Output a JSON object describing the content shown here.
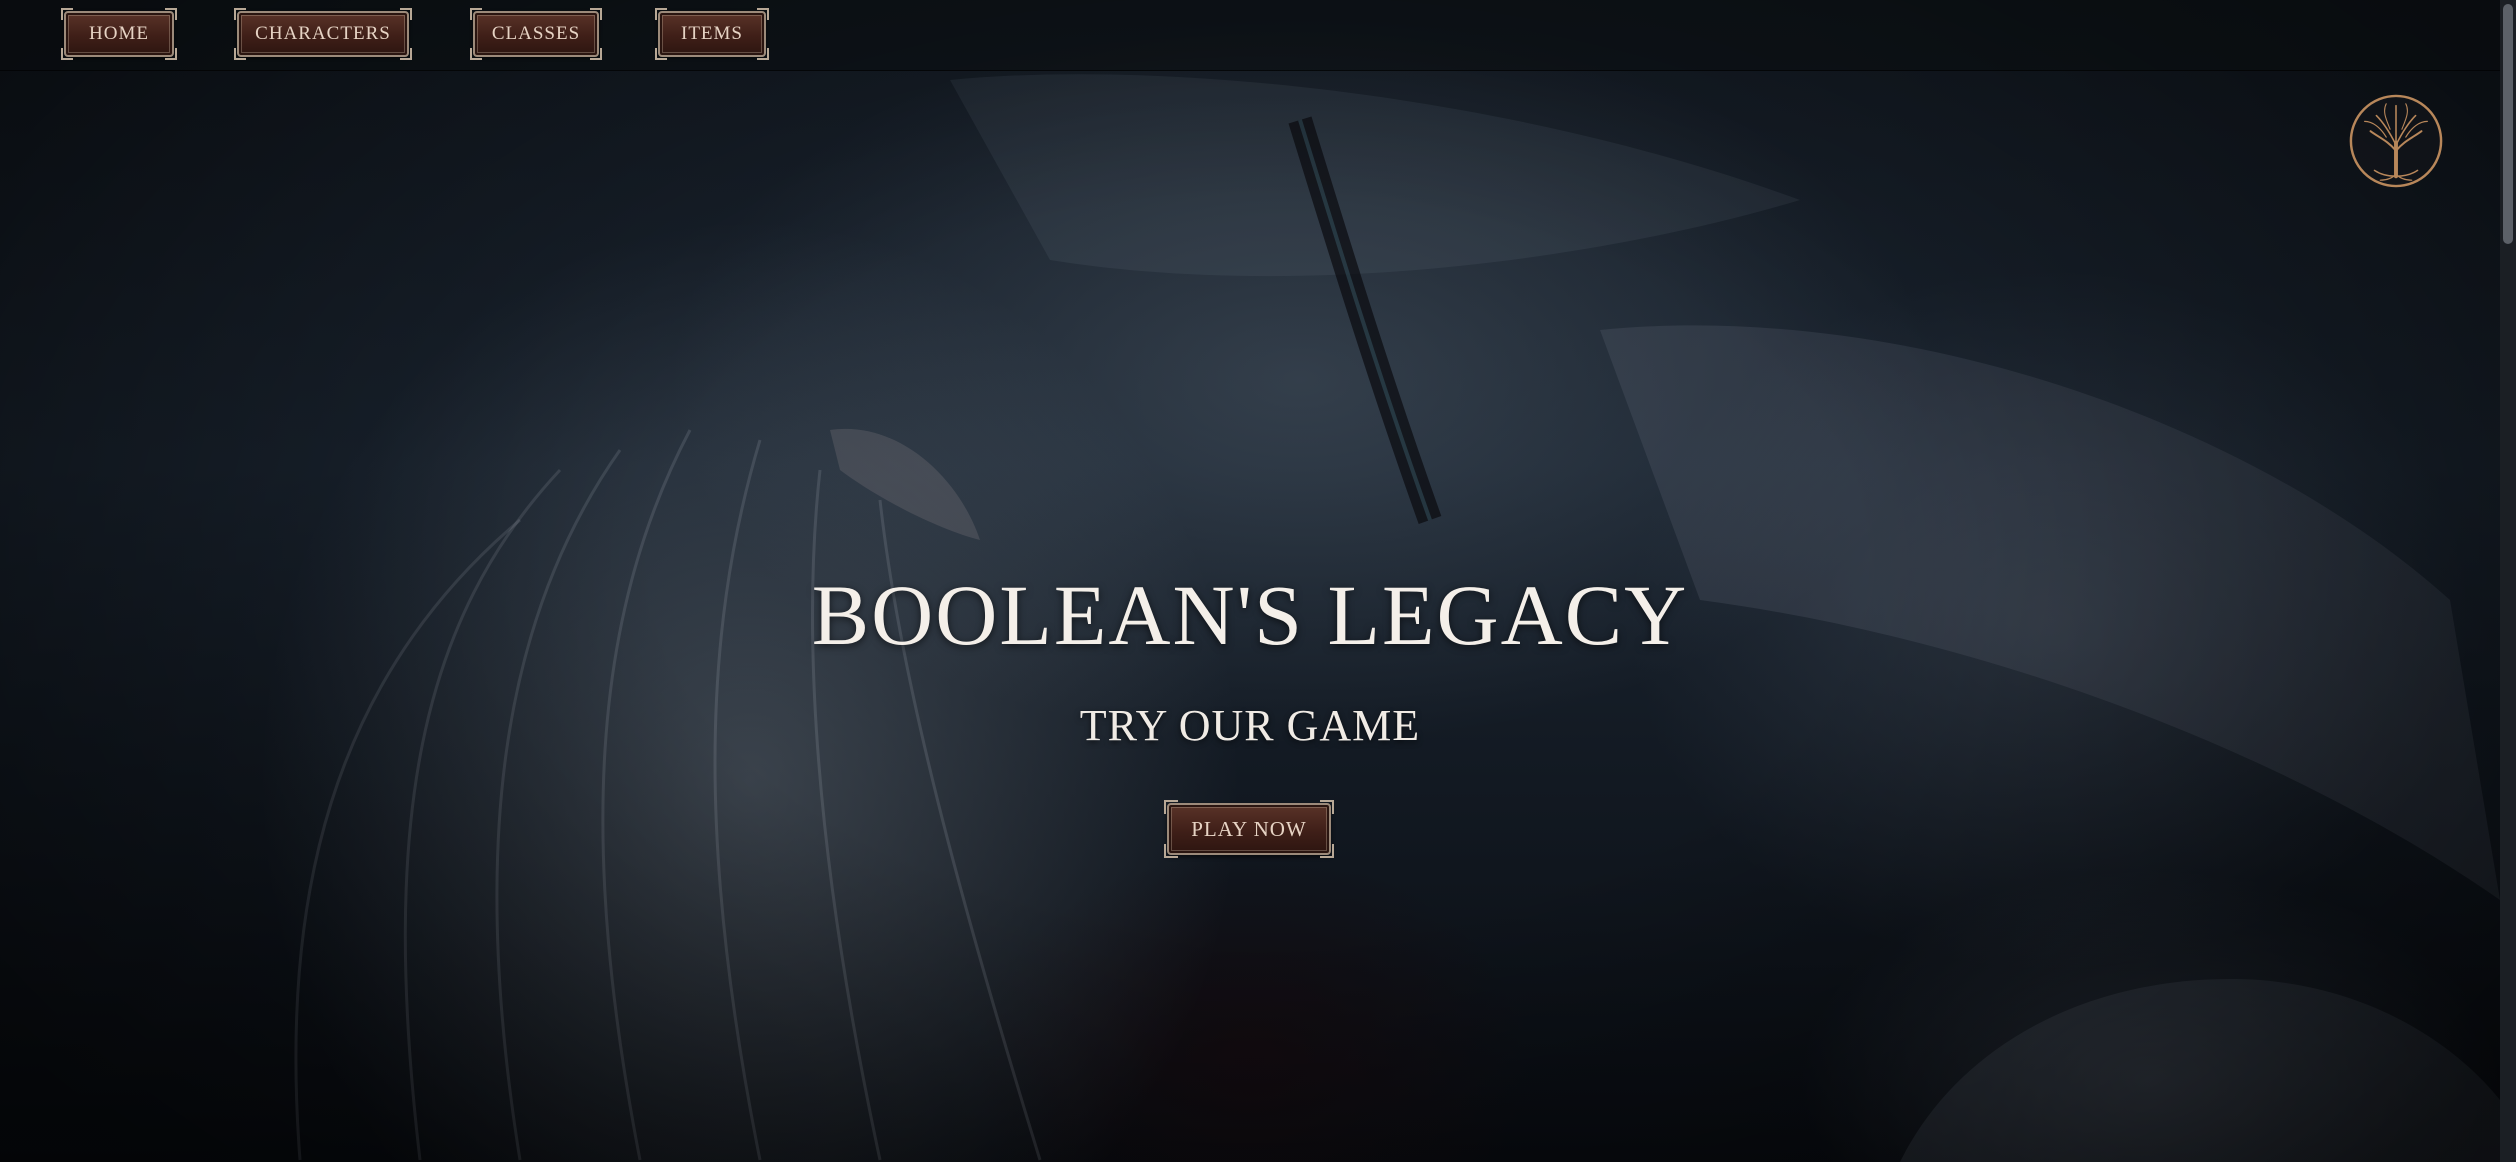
{
  "nav": {
    "items": [
      {
        "label": "HOME"
      },
      {
        "label": "CHARACTERS"
      },
      {
        "label": "CLASSES"
      },
      {
        "label": "ITEMS"
      }
    ]
  },
  "logo": {
    "icon": "tree-of-life-icon"
  },
  "hero": {
    "title": "BOOLEAN'S LEGACY",
    "subtitle": "TRY OUR GAME",
    "cta_label": "PLAY NOW"
  },
  "colors": {
    "button_fill": "#3f1f18",
    "button_border": "#9c8a7a",
    "text_light": "#f4efe9",
    "logo_gold": "#b8875a"
  }
}
